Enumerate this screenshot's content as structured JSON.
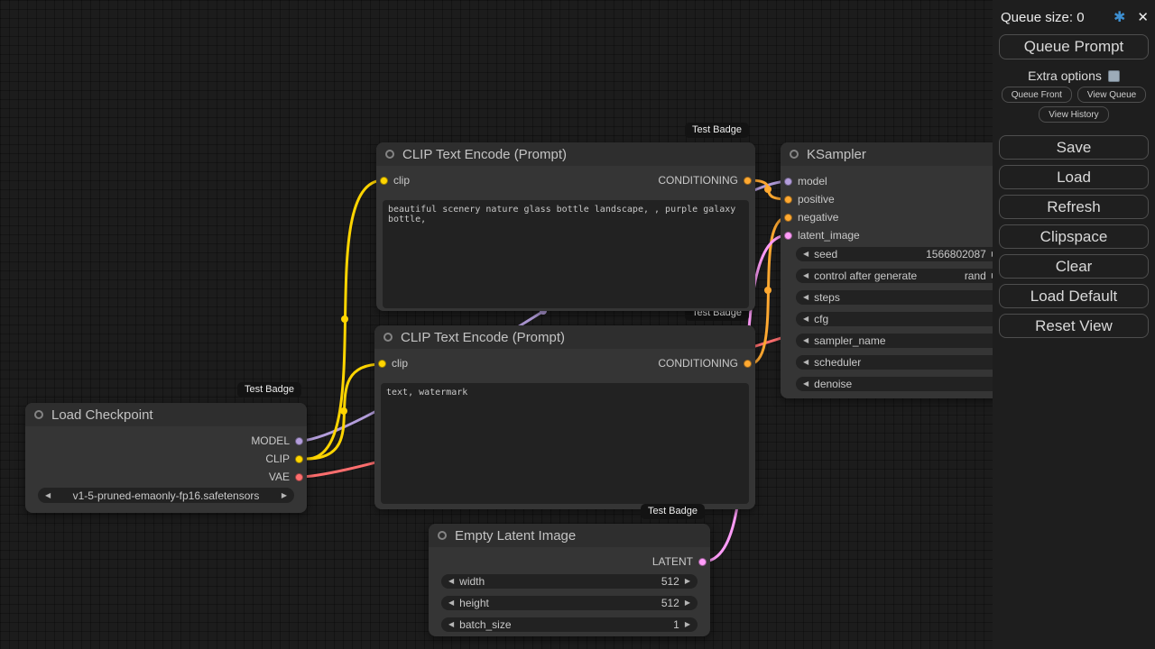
{
  "badge_text": "Test Badge",
  "icons": {
    "settings": "✱",
    "close": "✕",
    "arrow_left": "◀",
    "arrow_right": "▶"
  },
  "colors": {
    "model": "#B39DDB",
    "clip": "#FFD500",
    "vae": "#FF6E6E",
    "conditioning": "#FFA931",
    "latent": "#FF9CF9"
  },
  "menu": {
    "queue_size": "Queue size: 0",
    "queue_prompt": "Queue Prompt",
    "extra_options": "Extra options",
    "queue_front": "Queue Front",
    "view_queue": "View Queue",
    "view_history": "View History",
    "save": "Save",
    "load": "Load",
    "refresh": "Refresh",
    "clipspace": "Clipspace",
    "clear": "Clear",
    "load_default": "Load Default",
    "reset_view": "Reset View"
  },
  "nodes": {
    "load_checkpoint": {
      "title": "Load Checkpoint",
      "outputs": [
        {
          "name": "MODEL"
        },
        {
          "name": "CLIP"
        },
        {
          "name": "VAE"
        }
      ],
      "ckpt_name": "v1-5-pruned-emaonly-fp16.safetensors"
    },
    "clip_positive": {
      "title": "CLIP Text Encode (Prompt)",
      "input": "clip",
      "output": "CONDITIONING",
      "text": "beautiful scenery nature glass bottle landscape, , purple galaxy bottle,"
    },
    "clip_negative": {
      "title": "CLIP Text Encode (Prompt)",
      "input": "clip",
      "output": "CONDITIONING",
      "text": "text, watermark"
    },
    "ksampler": {
      "title": "KSampler",
      "inputs": [
        "model",
        "positive",
        "negative",
        "latent_image"
      ],
      "widgets": [
        {
          "label": "seed",
          "value": "1566802087"
        },
        {
          "label": "control after generate",
          "value": "rand"
        },
        {
          "label": "steps",
          "value": ""
        },
        {
          "label": "cfg",
          "value": ""
        },
        {
          "label": "sampler_name",
          "value": ""
        },
        {
          "label": "scheduler",
          "value": ""
        },
        {
          "label": "denoise",
          "value": ""
        }
      ]
    },
    "empty_latent": {
      "title": "Empty Latent Image",
      "output": "LATENT",
      "widgets": [
        {
          "label": "width",
          "value": "512"
        },
        {
          "label": "height",
          "value": "512"
        },
        {
          "label": "batch_size",
          "value": "1"
        }
      ]
    }
  }
}
